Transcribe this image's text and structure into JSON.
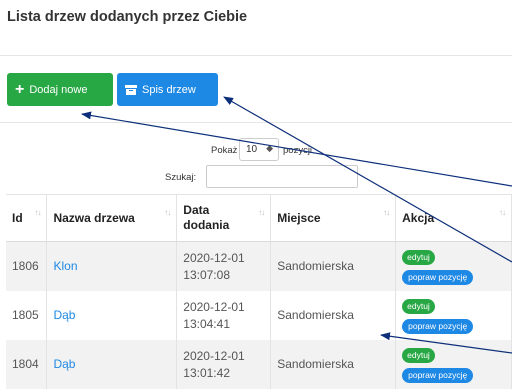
{
  "page": {
    "title": "Lista drzew dodanych przez Ciebie"
  },
  "toolbar": {
    "add_label": "Dodaj nowe",
    "list_label": "Spis drzew"
  },
  "table_controls": {
    "show_label": "Pokaż",
    "show_value": "10",
    "entries_label": "pozycji",
    "search_label": "Szukaj:",
    "search_value": ""
  },
  "table": {
    "headers": [
      "Id",
      "Nazwa drzewa",
      "Data dodania",
      "Miejsce",
      "Akcja"
    ],
    "rows": [
      {
        "id": "1806",
        "name": "Klon",
        "date": "2020-12-01",
        "time": "13:07:08",
        "place": "Sandomierska",
        "edit": "edytuj",
        "fix": "popraw pozycję"
      },
      {
        "id": "1805",
        "name": "Dąb",
        "date": "2020-12-01",
        "time": "13:04:41",
        "place": "Sandomierska",
        "edit": "edytuj",
        "fix": "popraw pozycję"
      },
      {
        "id": "1804",
        "name": "Dąb",
        "date": "2020-12-01",
        "time": "13:01:42",
        "place": "Sandomierska",
        "edit": "edytuj",
        "fix": "popraw pozycję"
      }
    ]
  },
  "colors": {
    "green": "#28a745",
    "blue": "#1e88e5",
    "arrow": "#0d2f7a"
  },
  "icons": {
    "add": "plus-icon",
    "list": "archive-box-icon",
    "sort": "sort-icon",
    "select": "select-arrow-icon"
  }
}
